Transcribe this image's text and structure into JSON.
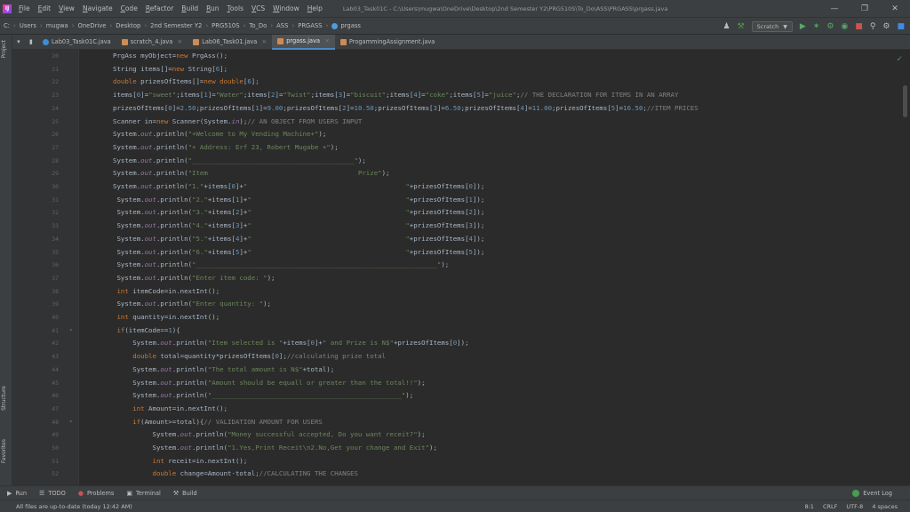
{
  "menu": [
    "File",
    "Edit",
    "View",
    "Navigate",
    "Code",
    "Refactor",
    "Build",
    "Run",
    "Tools",
    "VCS",
    "Window",
    "Help"
  ],
  "window_title": "Lab03_Task01C - C:\\Users\\mugwa\\OneDrive\\Desktop\\2nd Semester Y2\\PRG510S\\To_Do\\ASS\\PRGASS\\prgass.java",
  "breadcrumbs": [
    "C:",
    "Users",
    "mugwa",
    "OneDrive",
    "Desktop",
    "2nd Semester Y2",
    "PRG510S",
    "To_Do",
    "ASS",
    "PRGASS",
    "prgass"
  ],
  "run_config": "Scratch",
  "tabs": [
    {
      "label": "Lab03_Task01C.java",
      "icon": "class-icon"
    },
    {
      "label": "scratch_4.java",
      "icon": "java-file-icon"
    },
    {
      "label": "Lab06_Task01.java",
      "icon": "java-file-icon"
    },
    {
      "label": "prgass.java",
      "icon": "java-file-icon",
      "active": true
    },
    {
      "label": "ProgammingAssignment.java",
      "icon": "java-file-icon"
    }
  ],
  "side_labels": {
    "project": "Project",
    "structure": "Structure",
    "favorites": "Favorites"
  },
  "code_lines": [
    {
      "n": "20",
      "code": [
        [
          "plain",
          "PrgAss myObject="
        ],
        [
          "kw",
          "new "
        ],
        [
          "plain",
          "PrgAss();"
        ]
      ]
    },
    {
      "n": "21",
      "code": [
        [
          "plain",
          "String items[]="
        ],
        [
          "kw",
          "new "
        ],
        [
          "plain",
          "String["
        ],
        [
          "num",
          "6"
        ],
        [
          "plain",
          "];"
        ]
      ]
    },
    {
      "n": "22",
      "code": [
        [
          "kw",
          "double "
        ],
        [
          "plain",
          "prizesOfItems[]="
        ],
        [
          "kw",
          "new double"
        ],
        [
          "plain",
          "["
        ],
        [
          "num",
          "6"
        ],
        [
          "plain",
          "];"
        ]
      ]
    },
    {
      "n": "23",
      "code": [
        [
          "plain",
          "items["
        ],
        [
          "num",
          "0"
        ],
        [
          "plain",
          "]="
        ],
        [
          "str",
          "\"sweet\""
        ],
        [
          "plain",
          ";items["
        ],
        [
          "num",
          "1"
        ],
        [
          "plain",
          "]="
        ],
        [
          "str",
          "\"Water\""
        ],
        [
          "plain",
          ";items["
        ],
        [
          "num",
          "2"
        ],
        [
          "plain",
          "]="
        ],
        [
          "str",
          "\"Twist\""
        ],
        [
          "plain",
          ";items["
        ],
        [
          "num",
          "3"
        ],
        [
          "plain",
          "]="
        ],
        [
          "str",
          "\"biscuit\""
        ],
        [
          "plain",
          ";items["
        ],
        [
          "num",
          "4"
        ],
        [
          "plain",
          "]="
        ],
        [
          "str",
          "\"coke\""
        ],
        [
          "plain",
          ";items["
        ],
        [
          "num",
          "5"
        ],
        [
          "plain",
          "]="
        ],
        [
          "str",
          "\"juice\""
        ],
        [
          "plain",
          ";"
        ],
        [
          "cmt",
          "// THE DECLARATION FOR ITEMS IN AN ARRAY"
        ]
      ]
    },
    {
      "n": "24",
      "code": [
        [
          "plain",
          "prizesOfItems["
        ],
        [
          "num",
          "0"
        ],
        [
          "plain",
          "]="
        ],
        [
          "num",
          "2.50"
        ],
        [
          "plain",
          ";prizesOfItems["
        ],
        [
          "num",
          "1"
        ],
        [
          "plain",
          "]="
        ],
        [
          "num",
          "9.00"
        ],
        [
          "plain",
          ";prizesOfItems["
        ],
        [
          "num",
          "2"
        ],
        [
          "plain",
          "]="
        ],
        [
          "num",
          "10.50"
        ],
        [
          "plain",
          ";prizesOfItems["
        ],
        [
          "num",
          "3"
        ],
        [
          "plain",
          "]="
        ],
        [
          "num",
          "6.50"
        ],
        [
          "plain",
          ";prizesOfItems["
        ],
        [
          "num",
          "4"
        ],
        [
          "plain",
          "]="
        ],
        [
          "num",
          "11.00"
        ],
        [
          "plain",
          ";prizesOfItems["
        ],
        [
          "num",
          "5"
        ],
        [
          "plain",
          "]="
        ],
        [
          "num",
          "16.50"
        ],
        [
          "plain",
          ";"
        ],
        [
          "cmt",
          "//ITEM PRICES"
        ]
      ]
    },
    {
      "n": "25",
      "code": [
        [
          "plain",
          "Scanner in="
        ],
        [
          "kw",
          "new "
        ],
        [
          "plain",
          "Scanner(System."
        ],
        [
          "field",
          "in"
        ],
        [
          "plain",
          ");"
        ],
        [
          "cmt",
          "// AN OBJECT FROM USERS INPUT"
        ]
      ]
    },
    {
      "n": "26",
      "code": [
        [
          "plain",
          "System."
        ],
        [
          "field",
          "out"
        ],
        [
          "plain",
          ".println("
        ],
        [
          "str",
          "\"+Welcome to My Vending Machine+\""
        ],
        [
          "plain",
          ");"
        ]
      ]
    },
    {
      "n": "27",
      "code": [
        [
          "plain",
          "System."
        ],
        [
          "field",
          "out"
        ],
        [
          "plain",
          ".println("
        ],
        [
          "str",
          "\"+ Address: Erf 23, Robert Mugabe +\""
        ],
        [
          "plain",
          ");"
        ]
      ]
    },
    {
      "n": "28",
      "code": [
        [
          "plain",
          "System."
        ],
        [
          "field",
          "out"
        ],
        [
          "plain",
          ".println("
        ],
        [
          "str",
          "\"_________________________________________\""
        ],
        [
          "plain",
          ");"
        ]
      ]
    },
    {
      "n": "29",
      "code": [
        [
          "plain",
          "System."
        ],
        [
          "field",
          "out"
        ],
        [
          "plain",
          ".println("
        ],
        [
          "str",
          "\"Item                                      Prize\""
        ],
        [
          "plain",
          ");"
        ]
      ]
    },
    {
      "n": "30",
      "code": [
        [
          "plain",
          "System."
        ],
        [
          "field",
          "out"
        ],
        [
          "plain",
          ".println("
        ],
        [
          "str",
          "\"1.\""
        ],
        [
          "plain",
          "+items["
        ],
        [
          "num",
          "0"
        ],
        [
          "plain",
          "]+"
        ],
        [
          "str",
          "\"                                        \""
        ],
        [
          "plain",
          "+prizesOfItems["
        ],
        [
          "num",
          "0"
        ],
        [
          "plain",
          "]);"
        ]
      ]
    },
    {
      "n": "31",
      "code": [
        [
          "plain",
          " System."
        ],
        [
          "field",
          "out"
        ],
        [
          "plain",
          ".println("
        ],
        [
          "str",
          "\"2.\""
        ],
        [
          "plain",
          "+items["
        ],
        [
          "num",
          "1"
        ],
        [
          "plain",
          "]+"
        ],
        [
          "str",
          "\"                                       \""
        ],
        [
          "plain",
          "+prizesOfItems["
        ],
        [
          "num",
          "1"
        ],
        [
          "plain",
          "]);"
        ]
      ]
    },
    {
      "n": "32",
      "code": [
        [
          "plain",
          " System."
        ],
        [
          "field",
          "out"
        ],
        [
          "plain",
          ".println("
        ],
        [
          "str",
          "\"3.\""
        ],
        [
          "plain",
          "+items["
        ],
        [
          "num",
          "2"
        ],
        [
          "plain",
          "]+"
        ],
        [
          "str",
          "\"                                       \""
        ],
        [
          "plain",
          "+prizesOfItems["
        ],
        [
          "num",
          "2"
        ],
        [
          "plain",
          "]);"
        ]
      ]
    },
    {
      "n": "33",
      "code": [
        [
          "plain",
          " System."
        ],
        [
          "field",
          "out"
        ],
        [
          "plain",
          ".println("
        ],
        [
          "str",
          "\"4.\""
        ],
        [
          "plain",
          "+items["
        ],
        [
          "num",
          "3"
        ],
        [
          "plain",
          "]+"
        ],
        [
          "str",
          "\"                                       \""
        ],
        [
          "plain",
          "+prizesOfItems["
        ],
        [
          "num",
          "3"
        ],
        [
          "plain",
          "]);"
        ]
      ]
    },
    {
      "n": "34",
      "code": [
        [
          "plain",
          " System."
        ],
        [
          "field",
          "out"
        ],
        [
          "plain",
          ".println("
        ],
        [
          "str",
          "\"5.\""
        ],
        [
          "plain",
          "+items["
        ],
        [
          "num",
          "4"
        ],
        [
          "plain",
          "]+"
        ],
        [
          "str",
          "\"                                       \""
        ],
        [
          "plain",
          "+prizesOfItems["
        ],
        [
          "num",
          "4"
        ],
        [
          "plain",
          "]);"
        ]
      ]
    },
    {
      "n": "35",
      "code": [
        [
          "plain",
          " System."
        ],
        [
          "field",
          "out"
        ],
        [
          "plain",
          ".println("
        ],
        [
          "str",
          "\"6.\""
        ],
        [
          "plain",
          "+items["
        ],
        [
          "num",
          "5"
        ],
        [
          "plain",
          "]+"
        ],
        [
          "str",
          "\"                                       \""
        ],
        [
          "plain",
          "+prizesOfItems["
        ],
        [
          "num",
          "5"
        ],
        [
          "plain",
          "]);"
        ]
      ]
    },
    {
      "n": "36",
      "code": [
        [
          "plain",
          " System."
        ],
        [
          "field",
          "out"
        ],
        [
          "plain",
          ".println("
        ],
        [
          "str",
          "\"_____________________________________________________________\""
        ],
        [
          "plain",
          ");"
        ]
      ]
    },
    {
      "n": "37",
      "code": [
        [
          "plain",
          " System."
        ],
        [
          "field",
          "out"
        ],
        [
          "plain",
          ".println("
        ],
        [
          "str",
          "\"Enter item code: \""
        ],
        [
          "plain",
          ");"
        ]
      ]
    },
    {
      "n": "38",
      "code": [
        [
          "kw",
          " int "
        ],
        [
          "plain",
          "itemCode=in.nextInt();"
        ]
      ]
    },
    {
      "n": "39",
      "code": [
        [
          "plain",
          " System."
        ],
        [
          "field",
          "out"
        ],
        [
          "plain",
          ".println("
        ],
        [
          "str",
          "\"Enter quantity: \""
        ],
        [
          "plain",
          ");"
        ]
      ]
    },
    {
      "n": "40",
      "code": [
        [
          "kw",
          " int "
        ],
        [
          "plain",
          "quantity=in.nextInt();"
        ]
      ]
    },
    {
      "n": "41",
      "fold": true,
      "code": [
        [
          "kw",
          " if"
        ],
        [
          "plain",
          "(itemCode=="
        ],
        [
          "num",
          "1"
        ],
        [
          "plain",
          "){"
        ]
      ]
    },
    {
      "n": "42",
      "code": [
        [
          "plain",
          "     System."
        ],
        [
          "field",
          "out"
        ],
        [
          "plain",
          ".println("
        ],
        [
          "str",
          "\"Item selected is \""
        ],
        [
          "plain",
          "+items["
        ],
        [
          "num",
          "0"
        ],
        [
          "plain",
          "]+"
        ],
        [
          "str",
          "\" and Prize is N$\""
        ],
        [
          "plain",
          "+prizesOfItems["
        ],
        [
          "num",
          "0"
        ],
        [
          "plain",
          "]);"
        ]
      ]
    },
    {
      "n": "43",
      "code": [
        [
          "kw",
          "     double "
        ],
        [
          "plain",
          "total=quantity*prizesOfItems["
        ],
        [
          "num",
          "0"
        ],
        [
          "plain",
          "];"
        ],
        [
          "cmt",
          "//calculating prize total"
        ]
      ]
    },
    {
      "n": "44",
      "code": [
        [
          "plain",
          "     System."
        ],
        [
          "field",
          "out"
        ],
        [
          "plain",
          ".println("
        ],
        [
          "str",
          "\"The total amount is N$\""
        ],
        [
          "plain",
          "+total);"
        ]
      ]
    },
    {
      "n": "45",
      "code": [
        [
          "plain",
          "     System."
        ],
        [
          "field",
          "out"
        ],
        [
          "plain",
          ".println("
        ],
        [
          "str",
          "\"Amount should be equall or greater than the total!!\""
        ],
        [
          "plain",
          ");"
        ]
      ]
    },
    {
      "n": "46",
      "code": [
        [
          "plain",
          "     System."
        ],
        [
          "field",
          "out"
        ],
        [
          "plain",
          ".println("
        ],
        [
          "str",
          "\"________________________________________________\""
        ],
        [
          "plain",
          ");"
        ]
      ]
    },
    {
      "n": "47",
      "code": [
        [
          "kw",
          "     int "
        ],
        [
          "plain",
          "Amount=in.nextInt();"
        ]
      ]
    },
    {
      "n": "48",
      "fold": true,
      "code": [
        [
          "kw",
          "     if"
        ],
        [
          "plain",
          "(Amount>=total){"
        ],
        [
          "cmt",
          "// VALIDATION AMOUNT FOR USERS"
        ]
      ]
    },
    {
      "n": "49",
      "code": [
        [
          "plain",
          "          System."
        ],
        [
          "field",
          "out"
        ],
        [
          "plain",
          ".println("
        ],
        [
          "str",
          "\"Money successful accepted, Do you want receit?\""
        ],
        [
          "plain",
          ");"
        ]
      ]
    },
    {
      "n": "50",
      "code": [
        [
          "plain",
          "          System."
        ],
        [
          "field",
          "out"
        ],
        [
          "plain",
          ".println("
        ],
        [
          "str",
          "\"1.Yes,Print Receit\\n2.No,Get your change and Exit\""
        ],
        [
          "plain",
          ");"
        ]
      ]
    },
    {
      "n": "51",
      "code": [
        [
          "kw",
          "          int "
        ],
        [
          "plain",
          "receit=in.nextInt();"
        ]
      ]
    },
    {
      "n": "52",
      "code": [
        [
          "kw",
          "          double "
        ],
        [
          "plain",
          "change=Amount-total;"
        ],
        [
          "cmt",
          "//CALCULATING THE CHANGES"
        ]
      ]
    }
  ],
  "tool_windows": [
    {
      "label": "Run",
      "icon": "run-icon"
    },
    {
      "label": "TODO",
      "icon": "todo-icon"
    },
    {
      "label": "Problems",
      "icon": "problems-icon"
    },
    {
      "label": "Terminal",
      "icon": "terminal-icon"
    },
    {
      "label": "Build",
      "icon": "build-icon"
    }
  ],
  "event_log": "Event Log",
  "status": {
    "message": "All files are up-to-date (today 12:42 AM)",
    "position": "8:1",
    "line_sep": "CRLF",
    "encoding": "UTF-8",
    "indent": "4 spaces"
  }
}
